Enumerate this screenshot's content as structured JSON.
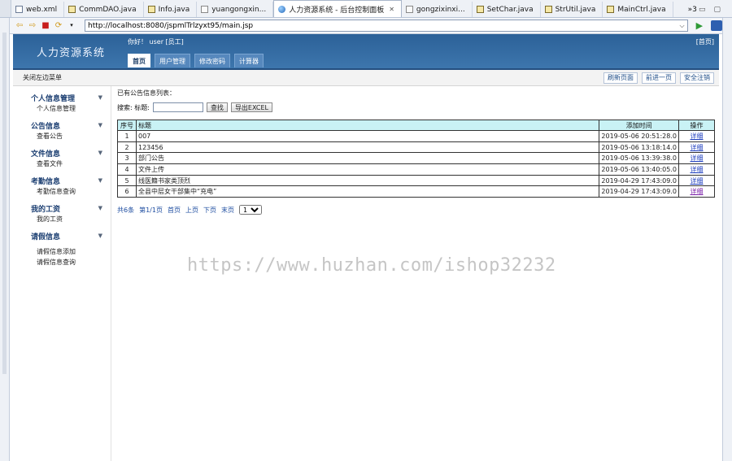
{
  "ide": {
    "tabs": [
      {
        "label": "web.xml",
        "icon": "xml-file-icon"
      },
      {
        "label": "CommDAO.java",
        "icon": "java-file-icon"
      },
      {
        "label": "Info.java",
        "icon": "java-file-icon"
      },
      {
        "label": "yuangongxin...",
        "icon": "jsp-file-icon"
      },
      {
        "label": "人力资源系统 - 后台控制面板",
        "icon": "globe-icon",
        "active": true
      },
      {
        "label": "gongzixinxi...",
        "icon": "jsp-file-icon"
      },
      {
        "label": "SetChar.java",
        "icon": "java-file-icon"
      },
      {
        "label": "StrUtil.java",
        "icon": "java-file-icon"
      },
      {
        "label": "MainCtrl.java",
        "icon": "java-file-icon"
      }
    ],
    "overflow_label": "»3"
  },
  "browser": {
    "url": "http://localhost:8080/jspmlTrlzyxt95/main.jsp"
  },
  "header": {
    "logo": "人力资源系统",
    "welcome": "你好！ user [员工]",
    "home_link": "[首页]",
    "tabs": [
      {
        "label": "首页",
        "active": true
      },
      {
        "label": "用户管理"
      },
      {
        "label": "修改密码"
      },
      {
        "label": "计算器"
      }
    ]
  },
  "subbar": {
    "collapse_label": "关闭左边菜单",
    "actions": [
      "刷新页面",
      "前进一页",
      "安全注销"
    ]
  },
  "sidebar": {
    "groups": [
      {
        "title": "个人信息管理",
        "items": [
          "个人信息管理"
        ]
      },
      {
        "title": "公告信息",
        "items": [
          "查看公告"
        ]
      },
      {
        "title": "文件信息",
        "items": [
          "查看文件"
        ]
      },
      {
        "title": "考勤信息",
        "items": [
          "考勤信息查询"
        ]
      },
      {
        "title": "我的工资",
        "items": [
          "我的工资"
        ]
      },
      {
        "title": "请假信息",
        "items": [
          "请假信息添加",
          "请假信息查询"
        ]
      }
    ]
  },
  "main": {
    "list_title": "已有公告信息列表：",
    "search_label": "搜索: 标题:",
    "search_button": "查找",
    "export_button": "导出EXCEL",
    "table": {
      "headers": [
        "序号",
        "标题",
        "添加时间",
        "操作"
      ],
      "rows": [
        {
          "idx": "1",
          "title": "007",
          "time": "2019-05-06 20:51:28.0",
          "action": "详细"
        },
        {
          "idx": "2",
          "title": "123456",
          "time": "2019-05-06 13:18:14.0",
          "action": "详细"
        },
        {
          "idx": "3",
          "title": "部门公告",
          "time": "2019-05-06 13:39:38.0",
          "action": "详细"
        },
        {
          "idx": "4",
          "title": "文件上传",
          "time": "2019-05-06 13:40:05.0",
          "action": "详细"
        },
        {
          "idx": "5",
          "title": "线医籍书家类顶烈",
          "time": "2019-04-29 17:43:09.0",
          "action": "详细"
        },
        {
          "idx": "6",
          "title": "全县中层女干部集中“充电”",
          "time": "2019-04-29 17:43:09.0",
          "action": "详细",
          "visited": true
        }
      ]
    },
    "pager": {
      "total": "共6条",
      "page": "第1/1页",
      "first": "首页",
      "prev": "上页",
      "next": "下页",
      "last": "末页",
      "selected": "1"
    }
  },
  "watermark": "https://www.huzhan.com/ishop32232",
  "colors": {
    "header_blue": "#2c6198",
    "table_head": "#c9f2f5",
    "link": "#1f3fbf"
  }
}
